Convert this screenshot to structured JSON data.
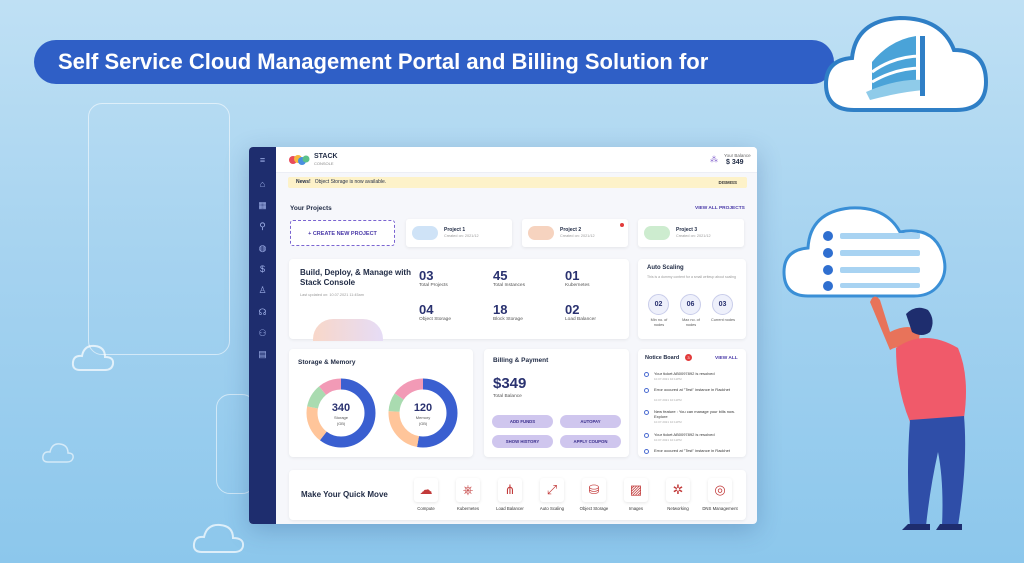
{
  "banner": {
    "title": "Self Service Cloud Management Portal and Billing Solution for"
  },
  "header": {
    "brand": "STACK",
    "brand_sub": "CONSOLE",
    "balance_label": "Your Balance",
    "balance_value": "$ 349"
  },
  "news": {
    "tag": "News!",
    "text": "Object Storage is now available.",
    "dismiss": "DISMISS"
  },
  "projects": {
    "title": "Your Projects",
    "view_all": "VIEW ALL PROJECTS",
    "create": "+ CREATE NEW PROJECT",
    "items": [
      {
        "name": "Project 1",
        "date": "Created on: 2021/12"
      },
      {
        "name": "Project 2",
        "date": "Created on: 2021/12"
      },
      {
        "name": "Project 3",
        "date": "Created on: 2021/12"
      }
    ]
  },
  "overview": {
    "title": "Build, Deploy, & Manage with Stack Console",
    "subtitle": "Last updated on: 10.07.2021 11:45am",
    "stats": [
      {
        "value": "03",
        "label": "Total Projects"
      },
      {
        "value": "45",
        "label": "Total Instances"
      },
      {
        "value": "01",
        "label": "Kubernetes"
      },
      {
        "value": "04",
        "label": "Object Storage"
      },
      {
        "value": "18",
        "label": "Block Storage"
      },
      {
        "value": "02",
        "label": "Load Balancer"
      }
    ]
  },
  "autoscaling": {
    "title": "Auto Scaling",
    "desc": "This is a dummy content for a small writeup about scaling",
    "items": [
      {
        "value": "02",
        "label": "Min no. of nodes"
      },
      {
        "value": "06",
        "label": "Max no. of nodes"
      },
      {
        "value": "03",
        "label": "Current nodes"
      }
    ]
  },
  "storage": {
    "title": "Storage & Memory",
    "donuts": [
      {
        "value": "340",
        "label": "Storage",
        "sub": "(GB)"
      },
      {
        "value": "120",
        "label": "Memory",
        "sub": "(GB)"
      }
    ]
  },
  "billing": {
    "title": "Billing & Payment",
    "amount": "$349",
    "caption": "Total Balance",
    "buttons": [
      "ADD FUNDS",
      "AUTOPAY",
      "SHOW HISTORY",
      "APPLY COUPON"
    ]
  },
  "notice": {
    "title": "Notice Board",
    "badge": "3",
    "view_all": "VIEW ALL",
    "items": [
      {
        "text": "Your ticket AB0097892 is resolved",
        "date": "10.07.2021 10:11PM"
      },
      {
        "text": "Error occured at \"Test\" instance in Rackhet",
        "date": "10.07.2021 10:11PM"
      },
      {
        "text": "New feature : You can manage your bills now. Explore",
        "date": "10.07.2021 10:11PM"
      },
      {
        "text": "Your ticket AB0097892 is resolved",
        "date": "10.07.2021 10:11PM"
      },
      {
        "text": "Error occured at \"Test\" instance in Rackhet",
        "date": "10.07.2021 10:11PM"
      }
    ]
  },
  "quickmove": {
    "title": "Make Your Quick Move",
    "items": [
      {
        "label": "Compute",
        "icon": "compute-icon"
      },
      {
        "label": "Kubernetes",
        "icon": "kubernetes-icon"
      },
      {
        "label": "Load Balancer",
        "icon": "load-balancer-icon"
      },
      {
        "label": "Auto Scaling",
        "icon": "auto-scaling-icon"
      },
      {
        "label": "Object Storage",
        "icon": "object-storage-icon"
      },
      {
        "label": "Images",
        "icon": "images-icon"
      },
      {
        "label": "Networking",
        "icon": "networking-icon"
      },
      {
        "label": "DNS Management",
        "icon": "dns-icon"
      }
    ]
  },
  "colors": {
    "banner": "#2f5fc6",
    "sidebar": "#1e2d6e",
    "accent": "#4a3aa8",
    "donut_primary": "#3a5fd0"
  }
}
